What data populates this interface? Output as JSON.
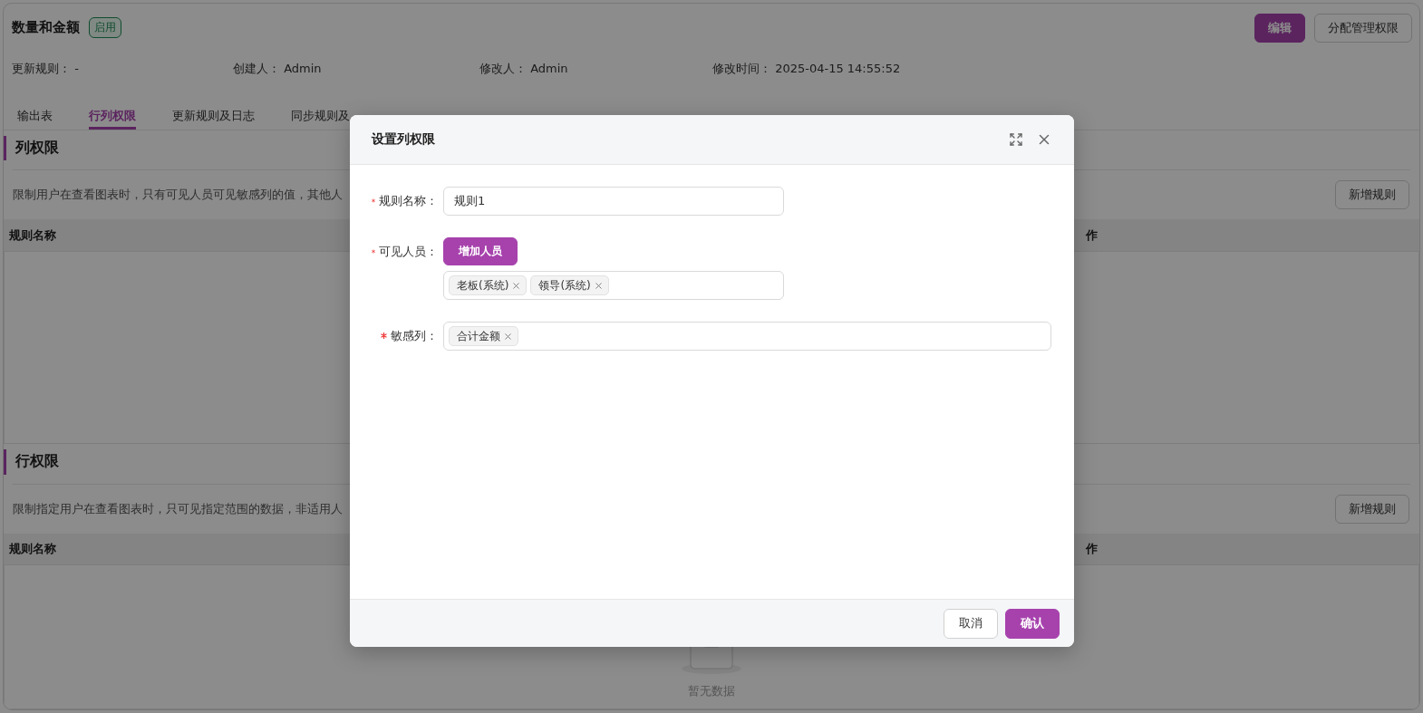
{
  "header": {
    "title": "数量和金额",
    "status_badge": "启用",
    "buttons": [
      {
        "label": "编辑",
        "kind": "primary"
      },
      {
        "label": "分配管理权限",
        "kind": "default"
      }
    ]
  },
  "meta": [
    {
      "label": "更新规则：",
      "value": "-"
    },
    {
      "label": "创建人：",
      "value": "Admin"
    },
    {
      "label": "修改人：",
      "value": "Admin"
    },
    {
      "label": "修改时间：",
      "value": "2025-04-15 14:55:52"
    }
  ],
  "tabs": [
    {
      "label": "输出表",
      "selected": false
    },
    {
      "label": "行列权限",
      "selected": true
    },
    {
      "label": "更新规则及日志",
      "selected": false
    },
    {
      "label": "同步规则及",
      "selected": false
    }
  ],
  "sections": [
    {
      "title": "列权限",
      "description": "限制用户在查看图表时，只有可见人员可见敏感列的值，其他人",
      "add_button": "新增规则",
      "columns": [
        "规则名称",
        "作"
      ]
    },
    {
      "title": "行权限",
      "description": "限制指定用户在查看图表时，只可见指定范围的数据，非适用人",
      "add_button": "新增规则",
      "columns": [
        "规则名称",
        "作"
      ],
      "empty_text": "暂无数据"
    }
  ],
  "dialog": {
    "title": "设置列权限",
    "fields": [
      {
        "kind": "input",
        "label": "规则名称：",
        "required": true,
        "value": "规则1"
      },
      {
        "kind": "people",
        "label": "可见人员：",
        "required": true,
        "button": "增加人员",
        "tags": [
          "老板(系统)",
          "领导(系统)"
        ]
      },
      {
        "kind": "tags",
        "label": "敏感列：",
        "required": true,
        "tags": [
          "合计金额"
        ]
      }
    ],
    "buttons": [
      {
        "label": "取消",
        "kind": "default"
      },
      {
        "label": "确认",
        "kind": "primary"
      }
    ]
  }
}
